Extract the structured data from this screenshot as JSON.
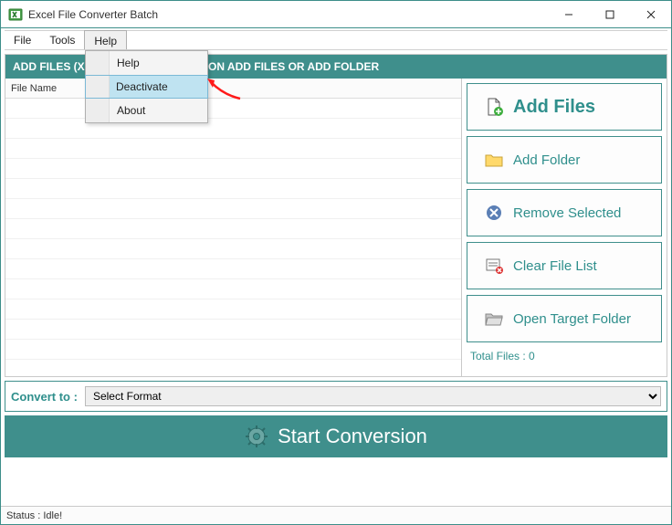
{
  "window": {
    "title": "Excel File Converter Batch"
  },
  "menubar": {
    "file": "File",
    "tools": "Tools",
    "help": "Help"
  },
  "helpmenu": {
    "help": "Help",
    "deactivate": "Deactivate",
    "about": "About"
  },
  "header": {
    "add_files_text": "ADD FILES (XLS, XLSX, CSV), CLICK ON ADD FILES OR ADD FOLDER"
  },
  "grid": {
    "col_filename": "File Name"
  },
  "sidebar": {
    "add_files": "Add Files",
    "add_folder": "Add Folder",
    "remove_selected": "Remove Selected",
    "clear_list": "Clear File List",
    "open_target": "Open Target Folder",
    "total_files_label": "Total Files : 0"
  },
  "convert": {
    "label": "Convert to :",
    "placeholder": "Select Format"
  },
  "start": {
    "label": "Start Conversion"
  },
  "status": {
    "text": "Status  :  Idle!"
  }
}
